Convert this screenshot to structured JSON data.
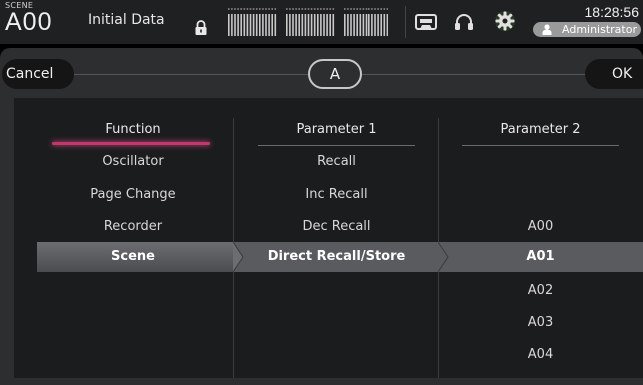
{
  "status": {
    "scene_label": "SCENE",
    "scene_number": "A00",
    "scene_name": "Initial Data",
    "time": "18:28:56",
    "user": "Administrator"
  },
  "toolbar": {
    "cancel_label": "Cancel",
    "bank_label": "A",
    "ok_label": "OK"
  },
  "columns": {
    "function": {
      "header": "Function",
      "items": [
        "Oscillator",
        "Page Change",
        "Recorder",
        "Scene"
      ],
      "selected": "Scene"
    },
    "parameter1": {
      "header": "Parameter 1",
      "items": [
        "Recall",
        "Inc Recall",
        "Dec Recall",
        "Direct Recall/Store"
      ],
      "selected": "Direct Recall/Store"
    },
    "parameter2": {
      "header": "Parameter 2",
      "items": [
        "A00",
        "A01",
        "A02",
        "A03",
        "A04"
      ],
      "selected": "A01"
    }
  },
  "icons": {
    "lock": "lock-icon",
    "recorder": "cassette-icon",
    "monitor": "headphones-icon",
    "setup": "gear-icon",
    "user": "person-icon"
  },
  "colors": {
    "accent_pink": "#c0396e",
    "selection": "#5a5b5e"
  }
}
